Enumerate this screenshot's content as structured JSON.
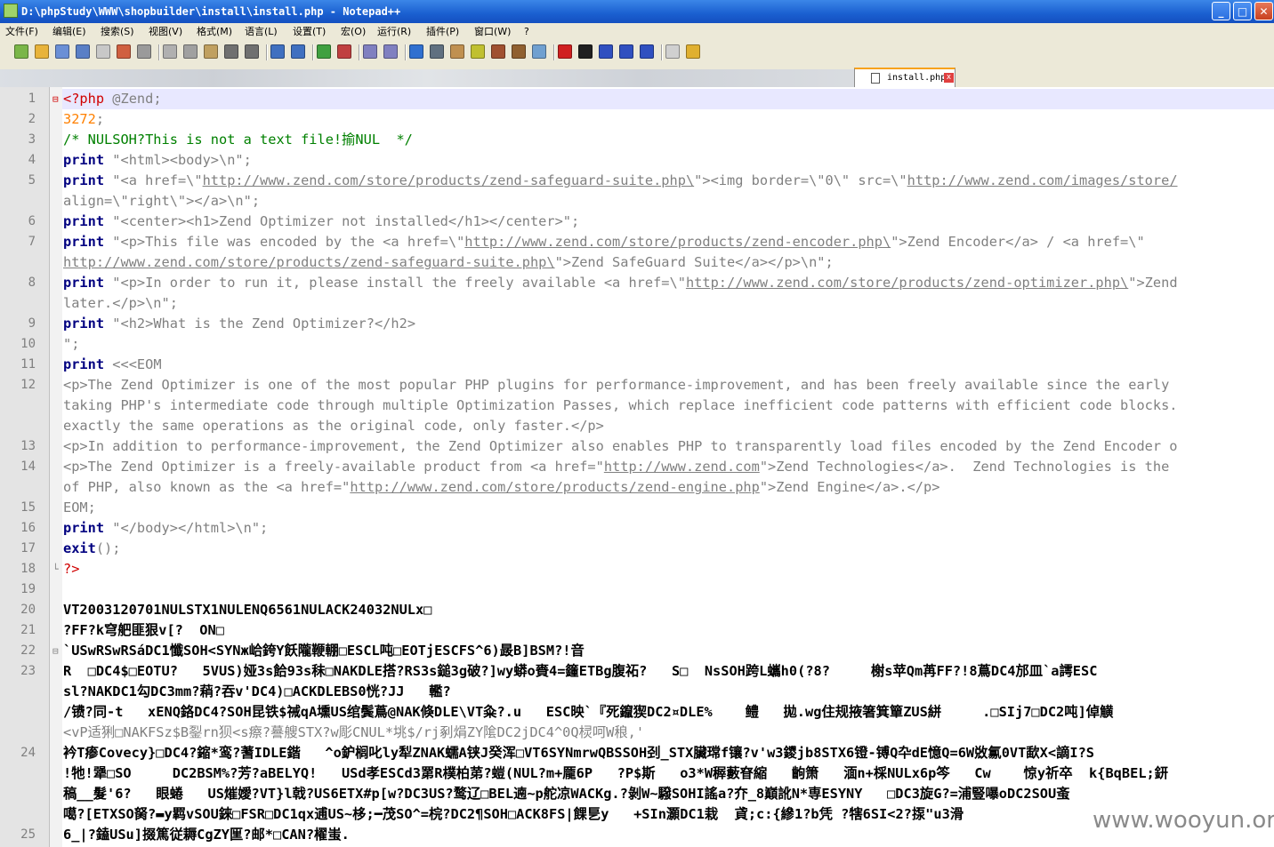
{
  "window": {
    "title": "D:\\phpStudy\\WWW\\shopbuilder\\install\\install.php - Notepad++",
    "minimize_label": "_",
    "maximize_label": "□",
    "close_label": "✕"
  },
  "menu": [
    {
      "label": "文件(F)"
    },
    {
      "label": "编辑(E)"
    },
    {
      "label": "搜索(S)"
    },
    {
      "label": "视图(V)"
    },
    {
      "label": "格式(M)"
    },
    {
      "label": "语言(L)"
    },
    {
      "label": "设置(T)"
    },
    {
      "label": "宏(O)"
    },
    {
      "label": "运行(R)"
    },
    {
      "label": "插件(P)"
    },
    {
      "label": "窗口(W)"
    },
    {
      "label": "?"
    }
  ],
  "toolbar": {
    "icons": [
      "new-file-icon",
      "open-file-icon",
      "save-icon",
      "save-all-icon",
      "close-icon",
      "close-all-icon",
      "print-icon",
      "cut-icon",
      "copy-icon",
      "paste-icon",
      "undo-icon",
      "redo-icon",
      "find-icon",
      "replace-icon",
      "zoom-in-icon",
      "zoom-out-icon",
      "sync-v-icon",
      "sync-h-icon",
      "word-wrap-icon",
      "show-all-chars-icon",
      "indent-guide-icon",
      "user-lang-icon",
      "doc-map-icon",
      "function-list-icon",
      "folder-workspace-icon",
      "record-macro-icon",
      "stop-record-icon",
      "play-macro-icon",
      "run-macro-multiple-icon",
      "save-macro-icon",
      "spell-check-icon",
      "plugin-icon"
    ]
  },
  "tab": {
    "label": "install.php",
    "close_label": "x"
  },
  "editor": {
    "current_line": 1,
    "lines": [
      {
        "n": "1",
        "fold": "⊟",
        "segs": [
          {
            "t": "<?php",
            "c": "php"
          },
          {
            "t": " @Zend;",
            "c": ""
          }
        ]
      },
      {
        "n": "2",
        "segs": [
          {
            "t": "3272",
            "c": "num"
          },
          {
            "t": ";",
            "c": ""
          }
        ]
      },
      {
        "n": "3",
        "segs": [
          {
            "t": "/* NULSOH?This is not a text file!揄NUL  */",
            "c": "cmt"
          }
        ]
      },
      {
        "n": "4",
        "segs": [
          {
            "t": "print",
            "c": "kw"
          },
          {
            "t": " \"<html><body>\\n\";",
            "c": ""
          }
        ]
      },
      {
        "n": "5",
        "segs": [
          {
            "t": "print",
            "c": "kw"
          },
          {
            "t": " \"<a href=\\\"",
            "c": ""
          },
          {
            "t": "http://www.zend.com/store/products/zend-safeguard-suite.php\\",
            "c": "lnk"
          },
          {
            "t": "\"><img border=\\\"0\\\" src=\\\"",
            "c": ""
          },
          {
            "t": "http://www.zend.com/images/store/",
            "c": "lnk"
          }
        ]
      },
      {
        "n": "",
        "segs": [
          {
            "t": "align=\\\"right\\\"></a>\\n\";",
            "c": ""
          }
        ]
      },
      {
        "n": "6",
        "segs": [
          {
            "t": "print",
            "c": "kw"
          },
          {
            "t": " \"<center><h1>Zend Optimizer not installed</h1></center>\";",
            "c": ""
          }
        ]
      },
      {
        "n": "7",
        "segs": [
          {
            "t": "print",
            "c": "kw"
          },
          {
            "t": " \"<p>This file was encoded by the <a href=\\\"",
            "c": ""
          },
          {
            "t": "http://www.zend.com/store/products/zend-encoder.php\\",
            "c": "lnk"
          },
          {
            "t": "\">Zend Encoder</a> / <a href=\\\"",
            "c": ""
          }
        ]
      },
      {
        "n": "",
        "segs": [
          {
            "t": "http://www.zend.com/store/products/zend-safeguard-suite.php\\",
            "c": "lnk"
          },
          {
            "t": "\">Zend SafeGuard Suite</a></p>\\n\";",
            "c": ""
          }
        ]
      },
      {
        "n": "8",
        "segs": [
          {
            "t": "print",
            "c": "kw"
          },
          {
            "t": " \"<p>In order to run it, please install the freely available <a href=\\\"",
            "c": ""
          },
          {
            "t": "http://www.zend.com/store/products/zend-optimizer.php\\",
            "c": "lnk"
          },
          {
            "t": "\">Zend",
            "c": ""
          }
        ]
      },
      {
        "n": "",
        "segs": [
          {
            "t": "later.</p>\\n\";",
            "c": ""
          }
        ]
      },
      {
        "n": "9",
        "segs": [
          {
            "t": "print",
            "c": "kw"
          },
          {
            "t": " \"<h2>What is the Zend Optimizer?</h2>",
            "c": ""
          }
        ]
      },
      {
        "n": "10",
        "segs": [
          {
            "t": "\";",
            "c": ""
          }
        ]
      },
      {
        "n": "11",
        "segs": [
          {
            "t": "print",
            "c": "kw"
          },
          {
            "t": " <<<EOM",
            "c": ""
          }
        ]
      },
      {
        "n": "12",
        "segs": [
          {
            "t": "<p>The Zend Optimizer is one of the most popular PHP plugins for performance-improvement, and has been freely available since the early",
            "c": ""
          }
        ]
      },
      {
        "n": "",
        "segs": [
          {
            "t": "taking PHP's intermediate code through multiple Optimization Passes, which replace inefficient code patterns with efficient code blocks.",
            "c": ""
          }
        ]
      },
      {
        "n": "",
        "segs": [
          {
            "t": "exactly the same operations as the original code, only faster.</p>",
            "c": ""
          }
        ]
      },
      {
        "n": "13",
        "segs": [
          {
            "t": "<p>In addition to performance-improvement, the Zend Optimizer also enables PHP to transparently load files encoded by the Zend Encoder o",
            "c": ""
          }
        ]
      },
      {
        "n": "14",
        "segs": [
          {
            "t": "<p>The Zend Optimizer is a freely-available product from <a href=\"",
            "c": ""
          },
          {
            "t": "http://www.zend.com",
            "c": "lnk"
          },
          {
            "t": "\">Zend Technologies</a>.  Zend Technologies is the",
            "c": ""
          }
        ]
      },
      {
        "n": "",
        "segs": [
          {
            "t": "of PHP, also known as the <a href=\"",
            "c": ""
          },
          {
            "t": "http://www.zend.com/store/products/zend-engine.php",
            "c": "lnk"
          },
          {
            "t": "\">Zend Engine</a>.</p>",
            "c": ""
          }
        ]
      },
      {
        "n": "15",
        "segs": [
          {
            "t": "EOM;",
            "c": ""
          }
        ]
      },
      {
        "n": "16",
        "segs": [
          {
            "t": "print",
            "c": "kw"
          },
          {
            "t": " \"</body></html>\\n\";",
            "c": ""
          }
        ]
      },
      {
        "n": "17",
        "segs": [
          {
            "t": "exit",
            "c": "kw"
          },
          {
            "t": "();",
            "c": ""
          }
        ]
      },
      {
        "n": "18",
        "fold": "└",
        "segs": [
          {
            "t": "?>",
            "c": "php"
          }
        ]
      },
      {
        "n": "19",
        "segs": []
      },
      {
        "n": "20",
        "segs": [
          {
            "t": "VT2003120701NULSTX1NULENQ6561NULACK24032NULx□",
            "c": "bin"
          }
        ]
      },
      {
        "n": "21",
        "segs": [
          {
            "t": "?FF?k穹舥匪狠v[?  ON□",
            "c": "bin"
          }
        ]
      },
      {
        "n": "22",
        "fold": "⊟",
        "segs": [
          {
            "t": "`USwRSwRSáDC1懺SOH<SYNж峆銙Y飫隴鞭輣□ESCL吨□EOTjESCFS^6)晸B]BSM?!音",
            "c": "bin"
          }
        ]
      },
      {
        "n": "23",
        "segs": [
          {
            "t": "R  □DC4$□EOTU?   5VUS)娅3s餄93s秣□NAKDLE搭?RS3s鎚3g破?]wy蟒o賚4=籦ETBg腹祏?   S□  NsSOH跨L蠵h0(?8?     榭s苹Qm苒FF?!8蔦DC4邡皿`a謣ESC",
            "c": "bin"
          }
        ]
      },
      {
        "n": "",
        "segs": [
          {
            "t": "sl?NAKDC1勾DC3mm?蕱?吞v'DC4)□ACKDLEBS0恍?JJ   轞?",
            "c": "bin"
          }
        ]
      },
      {
        "n": "",
        "segs": [
          {
            "t": "/镄?同-t   xENQ鉻DC4?SOH昆铁$祴qA壎US绾鬓蔦@NAK倏DLE\\VT粂?.u   ESC映`『死鑹猰DC2¤DLE%    鳢   拋.wg住规掖箸箕簞ZUS絣     .□SIj7□DC2吨]倬觵",
            "c": "bin"
          }
        ]
      },
      {
        "n": "",
        "segs": [
          {
            "t": "<vP适猁□NAKFSz$B銐rn狈<s瘵?謩艘STX?w彫CNUL*垗$/rj剢焆ZY隂DC2jDC4^0Q棂呵W稂,'",
            "c": ""
          }
        ]
      },
      {
        "n": "24",
        "segs": [
          {
            "t": "衿T瘆Covecy}□DC4?鏥*鸾?蓍IDLE鍇   ^o鈩榈叱ly犁ZNAK蠕A铗J癸浑□VT6SYNmrwQBSSOH刭_STX臟瑺f镶?v'w3鑁jb8STX6镫-镈Q卆dE憶Q=6W敚氱0VT歃X<謫I?S",
            "c": "bin"
          }
        ]
      },
      {
        "n": "",
        "segs": [
          {
            "t": "!牠!犟□SO     DC2BSM%?芳?aBELYQ!   USd孝ESCd3罤R樸柏苐?螘(NUL?m+龎6P   ?P$斯   o3*W稺藪眘縮   齣箫   湎n+棌NULx6p笒   Cw    惊y祈卒  k{BqBEL;鈃",
            "c": "bin"
          }
        ]
      },
      {
        "n": "",
        "segs": [
          {
            "t": "稿__髮'6?   眼蜷   US熣嬡?VT}l戟?US6ETX#p[w?DC3US?鹜辽□BEL遖~p舵凉WACKg.?剝W~驋SOHI謠a?夰_8巔訛N*専ESYNY   □DC3旋G?=浦豎嚗oDC2SOU蚉",
            "c": "bin"
          }
        ]
      },
      {
        "n": "",
        "segs": [
          {
            "t": "噶?[ETXSO胬?▬y羁vSOU錸□FSR□DC1qx逋US~栘;━茂SO^=梡?DC2¶SOH□ACK8FS|餜乬y   +SIn灝DC1栽  貣;c:{縿1?b凭 ?犗6SI<2?揼\"u3滑",
            "c": "bin"
          }
        ]
      },
      {
        "n": "25",
        "segs": [
          {
            "t": "6_|?鎑USu]掇篤従耨CgZY匩?邮*□CAN?櫂蚩.",
            "c": "bin"
          }
        ]
      }
    ]
  },
  "watermark": "www.wooyun.org",
  "colors": {
    "keyword": "#000080",
    "php_tag": "#d00000",
    "number": "#ff8000",
    "comment": "#008000",
    "string": "#808080",
    "current_line": "#e8e8ff",
    "tab_accent": "#f7a21c"
  }
}
